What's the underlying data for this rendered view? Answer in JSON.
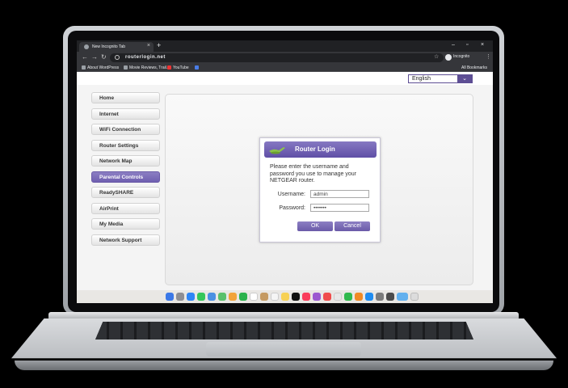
{
  "browser": {
    "tab_title": "New Incognito Tab",
    "new_tab_symbol": "+",
    "url": "routerlogin.net",
    "profile_label": "Incognito",
    "bookmarks": [
      "About WordPress",
      "Movie Reviews, Trail...",
      "YouTube"
    ],
    "all_bookmarks": "All Bookmarks"
  },
  "header": {
    "language": "English"
  },
  "sidebar": {
    "items": [
      {
        "label": "Home"
      },
      {
        "label": "Internet"
      },
      {
        "label": "WiFi Connection"
      },
      {
        "label": "Router Settings"
      },
      {
        "label": "Network Map"
      },
      {
        "label": "Parental Controls"
      },
      {
        "label": "ReadySHARE"
      },
      {
        "label": "AirPrint"
      },
      {
        "label": "My Media"
      },
      {
        "label": "Network Support"
      }
    ],
    "active_index": 5
  },
  "login_dialog": {
    "title": "Router Login",
    "message": "Please enter the username and password you use to manage your NETGEAR router.",
    "username_label": "Username:",
    "username_value": "admin",
    "password_label": "Password:",
    "password_value": "•••••••",
    "ok_label": "OK",
    "cancel_label": "Cancel"
  },
  "colors": {
    "accent": "#6f5fb0",
    "browser_dark": "#202124"
  }
}
